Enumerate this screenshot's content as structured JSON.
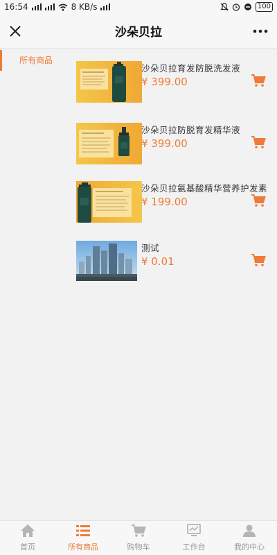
{
  "status_bar": {
    "time": "16:54",
    "network_speed": "8 KB/s",
    "battery": "100"
  },
  "header": {
    "title": "沙朵贝拉"
  },
  "categories": [
    {
      "label": "所有商品",
      "active": true
    }
  ],
  "products": [
    {
      "name": "沙朵贝拉育发防脱洗发液",
      "price": "¥ 399.00",
      "image": "shampoo-product-image"
    },
    {
      "name": "沙朵贝拉防脱育发精华液",
      "price": "¥ 399.00",
      "image": "essence-product-image"
    },
    {
      "name": "沙朵贝拉氨基酸精华营养护发素",
      "price": "¥ 199.00",
      "image": "conditioner-product-image"
    },
    {
      "name": "测试",
      "price": "¥ 0.01",
      "image": "city-buildings-image"
    }
  ],
  "tabs": [
    {
      "label": "首页",
      "icon": "home-icon",
      "active": false
    },
    {
      "label": "所有商品",
      "icon": "list-icon",
      "active": true
    },
    {
      "label": "购物车",
      "icon": "cart-icon",
      "active": false
    },
    {
      "label": "工作台",
      "icon": "monitor-icon",
      "active": false
    },
    {
      "label": "我的中心",
      "icon": "user-icon",
      "active": false
    }
  ],
  "colors": {
    "accent": "#f07a3a",
    "inactive": "#b5b5b5",
    "background": "#f2f2f2"
  }
}
